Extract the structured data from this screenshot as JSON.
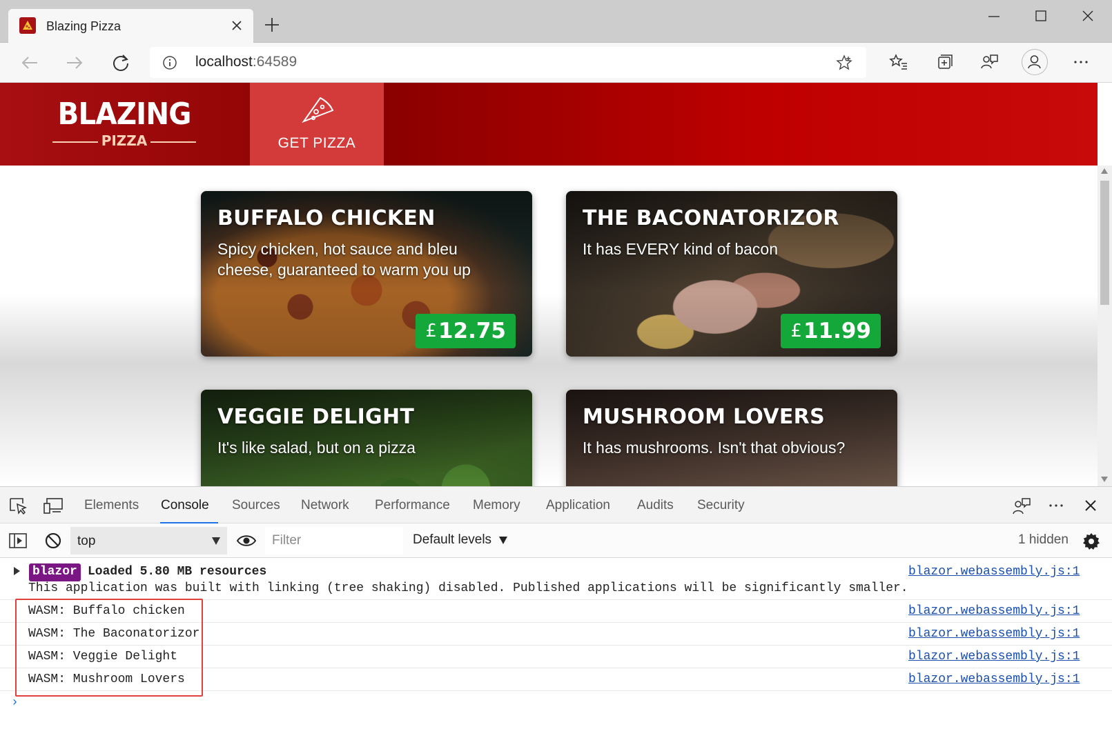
{
  "browser": {
    "tab_title": "Blazing Pizza",
    "url_host": "localhost",
    "url_port": ":64589"
  },
  "site": {
    "logo_main": "BLAZING",
    "logo_sub": "PIZZA",
    "nav_label": "GET PIZZA"
  },
  "pizzas": [
    {
      "name": "BUFFALO CHICKEN",
      "description": "Spicy chicken, hot sauce and bleu cheese, guaranteed to warm you up",
      "currency": "£",
      "price": "12.75"
    },
    {
      "name": "THE BACONATORIZOR",
      "description": "It has EVERY kind of bacon",
      "currency": "£",
      "price": "11.99"
    },
    {
      "name": "VEGGIE DELIGHT",
      "description": "It's like salad, but on a pizza"
    },
    {
      "name": "MUSHROOM LOVERS",
      "description": "It has mushrooms. Isn't that obvious?"
    }
  ],
  "devtools": {
    "tabs": [
      "Elements",
      "Console",
      "Sources",
      "Network",
      "Performance",
      "Memory",
      "Application",
      "Audits",
      "Security"
    ],
    "active_tab": "Console",
    "context": "top",
    "filter_placeholder": "Filter",
    "levels": "Default levels",
    "hidden": "1 hidden"
  },
  "console": {
    "badge": "blazor",
    "loaded_msg": "Loaded 5.80 MB resources",
    "linking_msg": "This application was built with linking (tree shaking) disabled. Published applications will be significantly smaller.",
    "source": "blazor.webassembly.js:1",
    "wasm_lines": [
      "WASM: Buffalo chicken",
      "WASM: The Baconatorizor",
      "WASM: Veggie Delight",
      "WASM: Mushroom Lovers"
    ],
    "prompt": "›"
  },
  "colors": {
    "header_red": "#c00000",
    "price_green": "#14a83b",
    "blazor_badge": "#7b1785",
    "highlight_box": "#e0413c",
    "link_blue": "#1a4fb0"
  }
}
